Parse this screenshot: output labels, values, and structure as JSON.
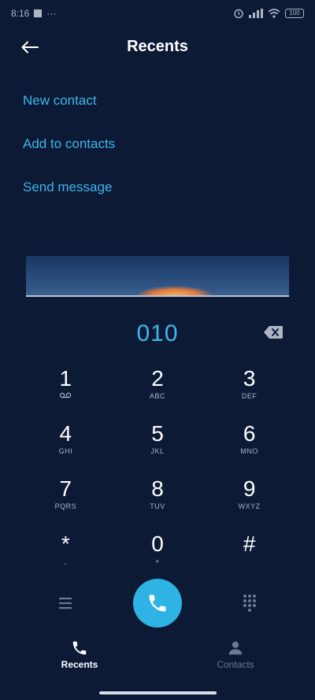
{
  "status_bar": {
    "time": "8:16",
    "dots": "···",
    "battery": "100"
  },
  "header": {
    "title": "Recents",
    "back_icon": "arrow-left-icon"
  },
  "actions": [
    {
      "label": "New contact"
    },
    {
      "label": "Add to contacts"
    },
    {
      "label": "Send message"
    }
  ],
  "dialer": {
    "number": "010"
  },
  "keypad": [
    {
      "digit": "1",
      "letters": "ᴏᴏ"
    },
    {
      "digit": "2",
      "letters": "ABC"
    },
    {
      "digit": "3",
      "letters": "DEF"
    },
    {
      "digit": "4",
      "letters": "GHI"
    },
    {
      "digit": "5",
      "letters": "JKL"
    },
    {
      "digit": "6",
      "letters": "MNO"
    },
    {
      "digit": "7",
      "letters": "PQRS"
    },
    {
      "digit": "8",
      "letters": "TUV"
    },
    {
      "digit": "9",
      "letters": "WXYZ"
    },
    {
      "digit": "*",
      "letters": ","
    },
    {
      "digit": "0",
      "letters": "+"
    },
    {
      "digit": "#",
      "letters": ""
    }
  ],
  "bottom_nav": {
    "recents_label": "Recents",
    "contacts_label": "Contacts"
  },
  "colors": {
    "background": "#0c1a36",
    "accent": "#3fb5e8",
    "call_button": "#2fb3e4",
    "inactive": "#6c7a92"
  }
}
